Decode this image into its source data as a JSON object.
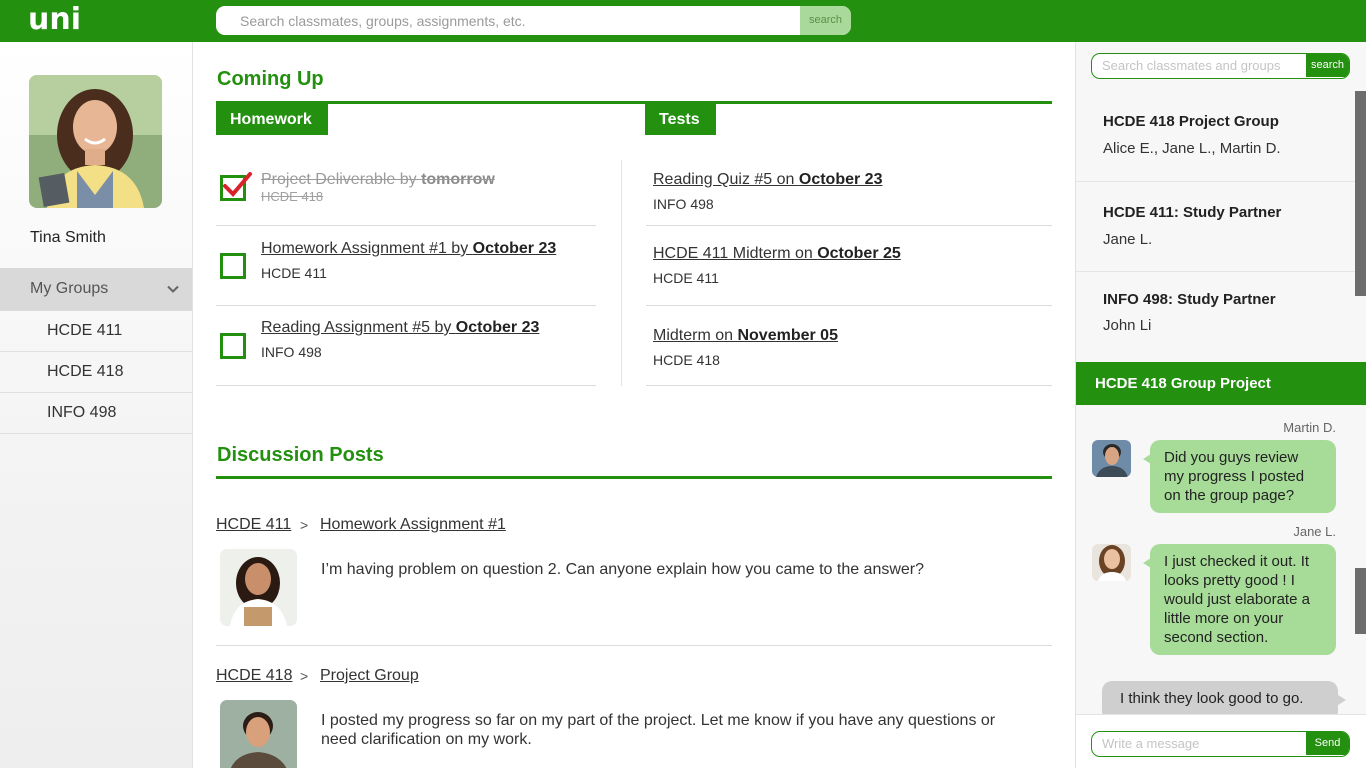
{
  "brand": {
    "logo": "uni",
    "accent": "#23900f"
  },
  "top_search": {
    "placeholder": "Search classmates, groups, assignments, etc.",
    "button": "search"
  },
  "profile": {
    "name": "Tina Smith"
  },
  "sidebar": {
    "groups_label": "My Groups",
    "groups": [
      {
        "label": "HCDE 411"
      },
      {
        "label": "HCDE 418"
      },
      {
        "label": "INFO 498"
      }
    ]
  },
  "coming_up": {
    "title": "Coming Up",
    "homework_tab": "Homework",
    "tests_tab": "Tests",
    "homework": [
      {
        "title": "Project Deliverable by ",
        "due": "tomorrow",
        "course": "HCDE 418",
        "done": true
      },
      {
        "title": "Homework Assignment #1 by ",
        "due": "October 23",
        "course": "HCDE 411",
        "done": false
      },
      {
        "title": "Reading Assignment #5 by ",
        "due": "October 23",
        "course": "INFO 498",
        "done": false
      }
    ],
    "tests": [
      {
        "title": "Reading Quiz #5 on ",
        "due": "October 23",
        "course": "INFO 498"
      },
      {
        "title": "HCDE 411 Midterm on ",
        "due": "October 25",
        "course": "HCDE 411"
      },
      {
        "title": "Midterm on ",
        "due": "November 05",
        "course": "HCDE 418"
      }
    ]
  },
  "discussion": {
    "title": "Discussion Posts",
    "separator": ">",
    "posts": [
      {
        "course": "HCDE 411",
        "topic": "Homework Assignment #1",
        "text": "I’m having problem on question 2.  Can anyone explain how you came to the answer?"
      },
      {
        "course": "HCDE 418",
        "topic": "Project Group",
        "text": "I posted my progress so far on my part of the project. Let me know if you have any questions or need clarification on my work."
      }
    ]
  },
  "right_search": {
    "placeholder": "Search classmates and groups",
    "button": "search"
  },
  "right_groups": [
    {
      "title": "HCDE 418 Project Group",
      "members": "Alice E., Jane L., Martin D."
    },
    {
      "title": "HCDE 411: Study Partner",
      "members": "Jane L."
    },
    {
      "title": "INFO 498: Study Partner",
      "members": "John Li"
    }
  ],
  "chat": {
    "title": "HCDE 418 Group Project",
    "messages": [
      {
        "sender": "Martin D.",
        "text": "Did you guys review my progress I posted on the group page?"
      },
      {
        "sender": "Jane L.",
        "text": "I just checked it out. It looks pretty good ! I would just elaborate a little more on your second section."
      },
      {
        "sender": "",
        "text": "I think they look good to go."
      }
    ],
    "input_placeholder": "Write a message",
    "send": "Send"
  }
}
